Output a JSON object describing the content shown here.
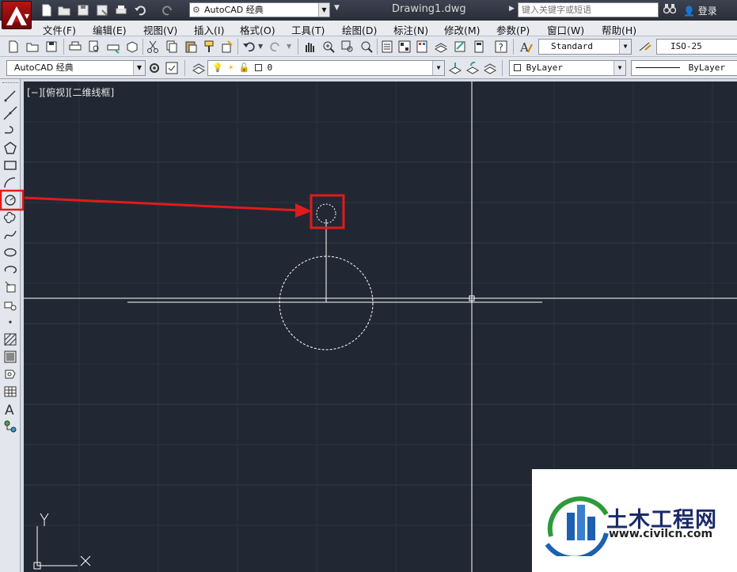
{
  "title_bar": {
    "workspace": "AutoCAD 经典",
    "document": "Drawing1.dwg",
    "search_placeholder": "键入关键字或短语",
    "login": "登录"
  },
  "menu": [
    "文件(F)",
    "编辑(E)",
    "视图(V)",
    "插入(I)",
    "格式(O)",
    "工具(T)",
    "绘图(D)",
    "标注(N)",
    "修改(M)",
    "参数(P)",
    "窗口(W)",
    "帮助(H)"
  ],
  "toolbar1": {
    "text_style": "Standard",
    "dim_style": "ISO-25"
  },
  "toolbar2": {
    "workspace": "AutoCAD 经典",
    "layer": "0",
    "color": "ByLayer",
    "linetype": "ByLayer"
  },
  "viewport": {
    "label": "[−][俯视][二维线框]"
  },
  "ucs": {
    "x": "X",
    "y": "Y"
  },
  "watermark": {
    "name": "土木工程网",
    "url": "www.civilcn.com"
  },
  "colors": {
    "canvas": "#222833",
    "highlight": "#e01b1b",
    "entity": "#ffffff"
  },
  "icons": {
    "left_toolbar": [
      "line",
      "construction-line",
      "polyline",
      "polygon",
      "rectangle",
      "arc",
      "circle",
      "revision-cloud",
      "spline",
      "ellipse",
      "ellipse-arc",
      "insert-block",
      "make-block",
      "point",
      "hatch",
      "gradient",
      "region",
      "table",
      "multiline-text",
      "add-selected"
    ]
  }
}
